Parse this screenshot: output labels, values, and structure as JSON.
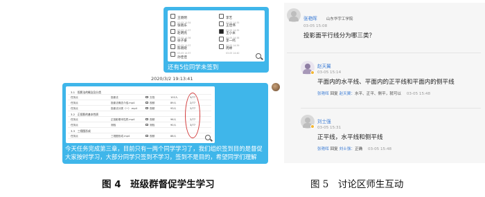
{
  "fig4": {
    "bubble1_caption": "还有5位同学未签到",
    "students": [
      {
        "name": "王晓明",
        "time": "03-05 14:34"
      },
      {
        "name": "李艺",
        "time": "03-05 14:35"
      },
      {
        "name": "张晓乐",
        "time": "03-05 14:37"
      },
      {
        "name": "王佳伟",
        "time": "03-05 14:35"
      },
      {
        "name": "赵明亮",
        "time": "03-05 14:36"
      },
      {
        "name": "王小米",
        "time": "03-05 14:38"
      },
      {
        "name": "徐子豪",
        "time": "03-05 14:37"
      },
      {
        "name": "李一鸣",
        "time": "03-05 14:39"
      },
      {
        "name": "陈晓晓",
        "time": "03-05 14:37"
      },
      {
        "name": "周婷",
        "time": "03-05 14:40"
      },
      {
        "name": "孙佳佳",
        "time": ""
      }
    ],
    "timestamp": "2020/3/2 19:13:41",
    "table_rows": [
      {
        "type": "section",
        "c1": "3.1　投影法的概念及分类",
        "c2": "",
        "c3": "",
        "c4": "",
        "c5": ""
      },
      {
        "type": "row",
        "c1": "任务点",
        "c2": "投影法",
        "c3": "文档",
        "c4": "102人",
        "c5": "3/77"
      },
      {
        "type": "row",
        "c1": "任务点",
        "c2": "投影法概念介绍.mp4",
        "c3": "视频",
        "c4": "89人",
        "c5": "2/77"
      },
      {
        "type": "row",
        "c1": "任务点",
        "c2": "投影法分类（一）.mp4",
        "c3": "视频",
        "c4": "93人",
        "c5": "2/77"
      },
      {
        "type": "section",
        "c1": "3.2　正投影的基本性质",
        "c2": "",
        "c3": "",
        "c4": "",
        "c5": ""
      },
      {
        "type": "row",
        "c1": "任务点",
        "c2": "正投影基本性质.mp4",
        "c3": "视频",
        "c4": "96人",
        "c5": "2/77"
      },
      {
        "type": "row",
        "c1": "任务点",
        "c2": "测验",
        "c3": "测验",
        "c4": "90人",
        "c5": "3/77"
      },
      {
        "type": "section",
        "c1": "3.3　三视图形成",
        "c2": "",
        "c3": "",
        "c4": "",
        "c5": ""
      },
      {
        "type": "row",
        "c1": "任务点",
        "c2": "三视图形成.mp4",
        "c3": "视频",
        "c4": "88人",
        "c5": ""
      }
    ],
    "bubble2_caption": "今天任务完成第三章，目前只有一两个同学学习了，我们组织签到目的是督促大家按时学习，大部分同学只签到不学习，签到不是目的，希望同学们理解",
    "figure_caption": "图 4　班级群督促学生学习"
  },
  "fig5": {
    "posts": [
      {
        "user": "张艳晖",
        "school": "山东华宇工学院",
        "time": "03-05 15:08",
        "text": "投影面平行线分为哪三类？"
      },
      {
        "user": "赵天翼",
        "time": "03-05 15:14",
        "text": "平面内的水平线、平面内的正平线和平面内的侧平线",
        "reply_user": "张艳晖",
        "reply_label": "回复",
        "reply_to": "赵天翼：",
        "reply_text": "水平、正平、侧平，就可以",
        "reply_time": "03-05 15:48"
      },
      {
        "user": "刘士强",
        "time": "03-05 15:31",
        "text": "正平线，水平线和侧平线",
        "reply_user": "张艳晖",
        "reply_label": "回复",
        "reply_to": "刘士强：",
        "reply_text": "正确",
        "reply_time": "03-05 15:48"
      }
    ],
    "figure_caption": "图 5　讨论区师生互动"
  }
}
